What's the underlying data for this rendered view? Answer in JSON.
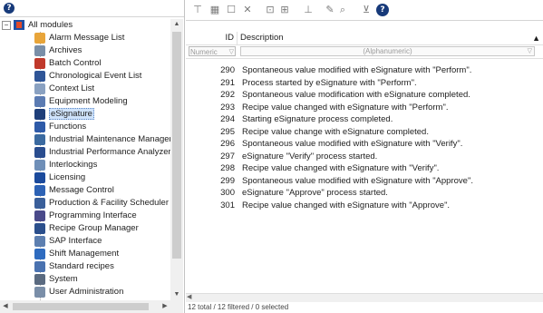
{
  "icons": {
    "help": "help-icon",
    "toolbar": [
      "filter-icon",
      "module-tile-icon",
      "window-icon",
      "delete-icon",
      "frame-icon",
      "export-icon",
      "funnel-icon",
      "edit-icon",
      "find-icon",
      "clear-filter-icon",
      "help-icon"
    ]
  },
  "help_glyph": "?",
  "tree": {
    "root_label": "All modules",
    "expander": "−",
    "items": [
      {
        "label": "Alarm Message List",
        "icon": "alarm-list-icon",
        "color": "#e8a53a"
      },
      {
        "label": "Archives",
        "icon": "archives-icon",
        "color": "#7a8fa8"
      },
      {
        "label": "Batch Control",
        "icon": "batch-control-icon",
        "color": "#c0392b"
      },
      {
        "label": "Chronological Event List",
        "icon": "event-list-icon",
        "color": "#2f5597"
      },
      {
        "label": "Context List",
        "icon": "context-list-icon",
        "color": "#8aa1c1"
      },
      {
        "label": "Equipment Modeling",
        "icon": "equipment-icon",
        "color": "#5b7bb2"
      },
      {
        "label": "eSignature",
        "icon": "esignature-icon",
        "color": "#1f3f7a",
        "selected": true
      },
      {
        "label": "Functions",
        "icon": "functions-icon",
        "color": "#2e5aa8"
      },
      {
        "label": "Industrial Maintenance Manager",
        "icon": "maintenance-icon",
        "color": "#3b6aa0"
      },
      {
        "label": "Industrial Performance Analyzer",
        "icon": "performance-icon",
        "color": "#2a4d8f"
      },
      {
        "label": "Interlockings",
        "icon": "interlocking-icon",
        "color": "#6f8fb8"
      },
      {
        "label": "Licensing",
        "icon": "licensing-icon",
        "color": "#1b4a9c"
      },
      {
        "label": "Message Control",
        "icon": "message-control-icon",
        "color": "#2d62b5"
      },
      {
        "label": "Production & Facility Scheduler",
        "icon": "scheduler-icon",
        "color": "#3a5f9a"
      },
      {
        "label": "Programming Interface",
        "icon": "programming-icon",
        "color": "#4a4a8a"
      },
      {
        "label": "Recipe Group Manager",
        "icon": "recipe-icon",
        "color": "#2b4f8c"
      },
      {
        "label": "SAP Interface",
        "icon": "sap-icon",
        "color": "#5d7fb0"
      },
      {
        "label": "Shift Management",
        "icon": "shift-icon",
        "color": "#2e6bbf"
      },
      {
        "label": "Standard recipes",
        "icon": "standard-recipe-icon",
        "color": "#4a72b0"
      },
      {
        "label": "System",
        "icon": "system-icon",
        "color": "#5a6a80"
      },
      {
        "label": "User Administration",
        "icon": "user-admin-icon",
        "color": "#7a8ea8"
      }
    ]
  },
  "grid": {
    "col_id": "ID",
    "col_desc": "Description",
    "sort_glyph": "▲",
    "filter_id": "Numeric",
    "filter_desc": "(Alphanumeric)",
    "filter_glyph": "▽",
    "rows": [
      {
        "id": "290",
        "desc": "Spontaneous value modified with eSignature with \"Perform\"."
      },
      {
        "id": "291",
        "desc": "Process started by eSignature with \"Perform\"."
      },
      {
        "id": "292",
        "desc": "Spontaneous value modification with eSignature completed."
      },
      {
        "id": "293",
        "desc": "Recipe value changed with eSignature with \"Perform\"."
      },
      {
        "id": "294",
        "desc": "Starting eSignature process completed."
      },
      {
        "id": "295",
        "desc": "Recipe value change with eSignature completed."
      },
      {
        "id": "296",
        "desc": "Spontaneous value modified with eSignature with \"Verify\"."
      },
      {
        "id": "297",
        "desc": "eSignature \"Verify\" process started."
      },
      {
        "id": "298",
        "desc": "Recipe value changed with eSignature with \"Verify\"."
      },
      {
        "id": "299",
        "desc": "Spontaneous value modified with eSignature with \"Approve\"."
      },
      {
        "id": "300",
        "desc": "eSignature \"Approve\" process started."
      },
      {
        "id": "301",
        "desc": "Recipe value changed with eSignature with \"Approve\"."
      }
    ]
  },
  "status": "12 total / 12 filtered / 0 selected"
}
